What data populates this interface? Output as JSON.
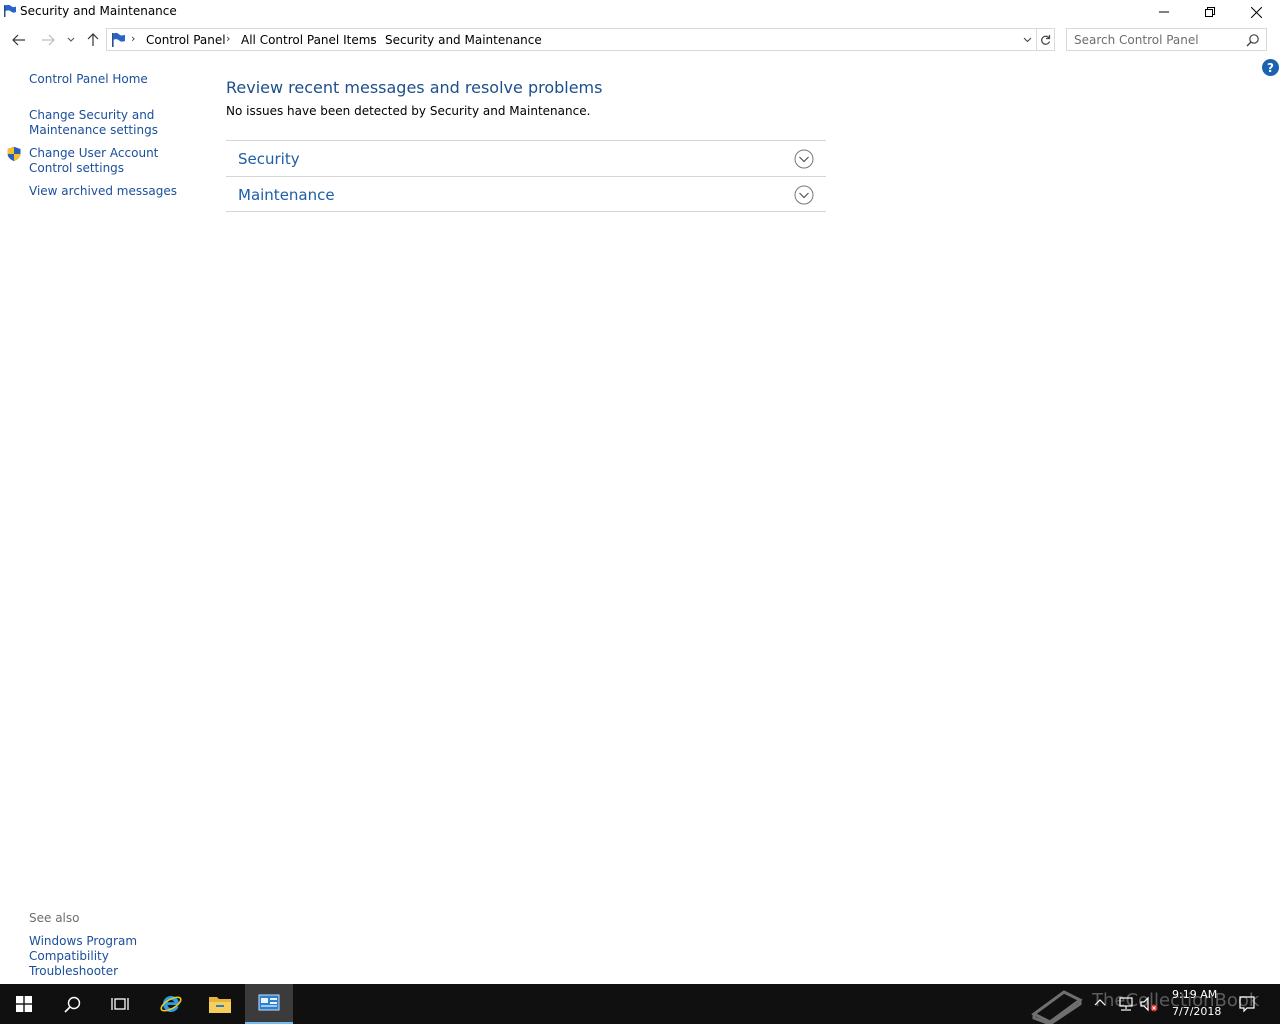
{
  "window": {
    "title": "Security and Maintenance"
  },
  "address": {
    "crumbs": [
      "Control Panel",
      "All Control Panel Items",
      "Security and Maintenance"
    ]
  },
  "search": {
    "placeholder": "Search Control Panel"
  },
  "help": {
    "label": "?"
  },
  "left_pane": {
    "home": "Control Panel Home",
    "change_security": "Change Security and Maintenance settings",
    "change_uac": "Change User Account Control settings",
    "archived": "View archived messages",
    "see_also_label": "See also",
    "compat": "Windows Program Compatibility Troubleshooter"
  },
  "main": {
    "title": "Review recent messages and resolve problems",
    "subtitle": "No issues have been detected by Security and Maintenance.",
    "sections": [
      {
        "label": "Security"
      },
      {
        "label": "Maintenance"
      }
    ]
  },
  "taskbar": {
    "watermark": "TheCollectionBook",
    "time": "9:19 AM",
    "date": "7/7/2018"
  },
  "colors": {
    "link": "#1a4f9c",
    "heading": "#1e4e8c",
    "taskbar": "#101010",
    "taskbar_active_accent": "#76b9ed"
  }
}
